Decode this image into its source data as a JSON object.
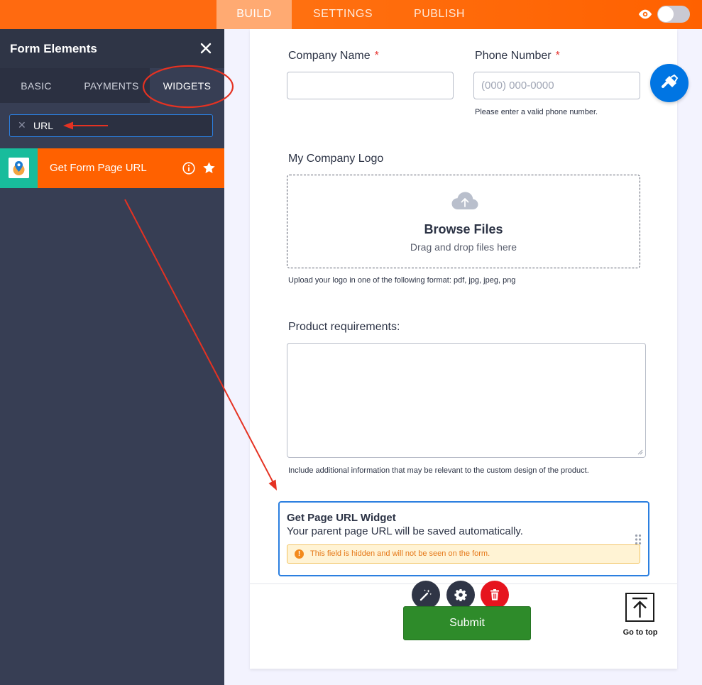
{
  "topbar": {
    "tabs": [
      {
        "label": "BUILD",
        "active": true
      },
      {
        "label": "SETTINGS",
        "active": false
      },
      {
        "label": "PUBLISH",
        "active": false
      }
    ],
    "preview_icon": "eye-icon"
  },
  "panel": {
    "title": "Form Elements",
    "tabs": [
      {
        "label": "BASIC"
      },
      {
        "label": "PAYMENTS"
      },
      {
        "label": "WIDGETS"
      }
    ],
    "search": {
      "value": "URL"
    },
    "results": [
      {
        "label": "Get Form Page URL"
      }
    ]
  },
  "form": {
    "company_name": {
      "label": "Company Name",
      "required": "*"
    },
    "phone": {
      "label": "Phone Number",
      "required": "*",
      "placeholder": "(000) 000-0000",
      "hint": "Please enter a valid phone number."
    },
    "logo": {
      "label": "My Company Logo",
      "browse": "Browse Files",
      "drag": "Drag and drop files here",
      "hint": "Upload your logo in one of the following format: pdf, jpg, jpeg, png"
    },
    "requirements": {
      "label": "Product requirements:",
      "hint": "Include additional information that may be relevant to the custom design of the product."
    },
    "widget": {
      "title": "Get Page URL Widget",
      "description": "Your parent page URL will be saved automatically.",
      "warning": "This field is hidden and will not be seen on the form."
    },
    "submit_label": "Submit"
  },
  "go_top": {
    "label": "Go to top"
  },
  "colors": {
    "accent": "#ff6100",
    "link_blue": "#2b7fe0",
    "submit_green": "#2e8b2a",
    "annotation_red": "#e53222"
  }
}
